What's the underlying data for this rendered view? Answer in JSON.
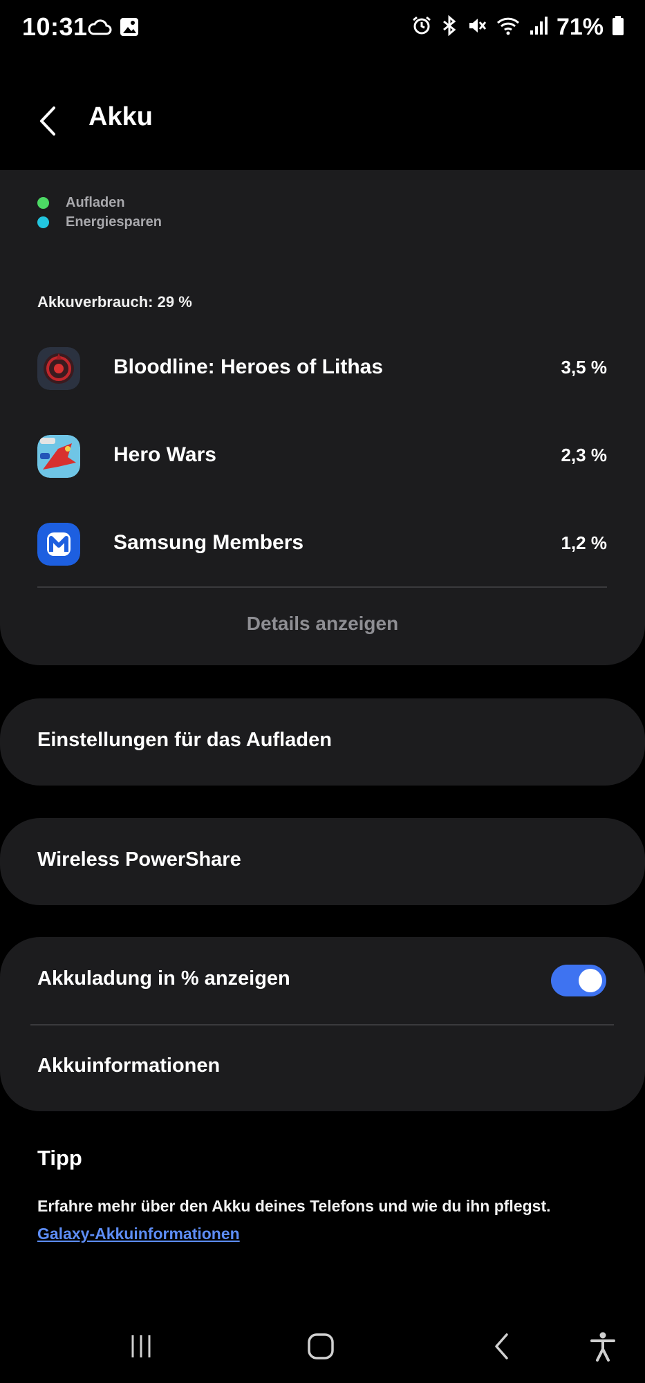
{
  "status_bar": {
    "time": "10:31",
    "battery_percent": "71%",
    "left_icons": [
      "cloud-icon",
      "image-icon"
    ],
    "right_icons": [
      "alarm-icon",
      "bluetooth-icon",
      "mute-icon",
      "wifi-icon",
      "signal-icon",
      "battery-icon"
    ]
  },
  "header": {
    "title": "Akku"
  },
  "legend": [
    {
      "label": "Aufladen",
      "color": "#4cd964"
    },
    {
      "label": "Energiesparen",
      "color": "#22c6e0"
    }
  ],
  "usage": {
    "total_label": "Akkuverbrauch: 29 %",
    "apps": [
      {
        "name": "Bloodline: Heroes of Lithas",
        "percent": "3,5 %",
        "icon": "bloodline-app-icon"
      },
      {
        "name": "Hero Wars",
        "percent": "2,3 %",
        "icon": "hero-wars-app-icon"
      },
      {
        "name": "Samsung Members",
        "percent": "1,2 %",
        "icon": "samsung-members-app-icon"
      }
    ],
    "details_label": "Details anzeigen"
  },
  "settings": {
    "charging_settings_label": "Einstellungen für das Aufladen",
    "wireless_powershare_label": "Wireless PowerShare",
    "show_percentage_label": "Akkuladung in % anzeigen",
    "show_percentage_enabled": true,
    "battery_info_label": "Akkuinformationen"
  },
  "tip": {
    "title": "Tipp",
    "text": "Erfahre mehr über den Akku deines Telefons und wie du ihn pflegst.",
    "link": "Galaxy-Akkuinformationen"
  },
  "colors": {
    "background": "#000000",
    "card": "#1c1c1e",
    "accent": "#3e73f1",
    "link": "#5d8df5"
  }
}
